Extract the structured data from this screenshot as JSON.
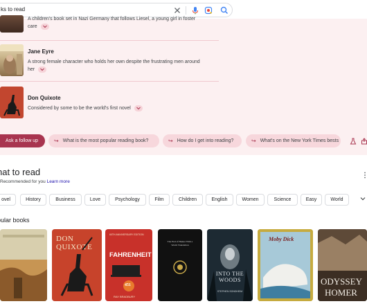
{
  "search": {
    "query": "ks to read"
  },
  "books": [
    {
      "title": "",
      "desc": "A children's book set in Nazi Germany that follows Liesel, a young girl in foster",
      "desc2": "care"
    },
    {
      "title": "Jane Eyre",
      "desc": "A strong female character who holds her own despite the frustrating men around",
      "desc2": "her"
    },
    {
      "title": "Don Quixote",
      "desc": "Considered by some to be the world's first novel",
      "desc2": ""
    }
  ],
  "followup": {
    "button_label": "Ask a follow up",
    "questions": [
      "What is the most popular reading book?",
      "How do I get into reading?",
      "What's on the New York Times bests"
    ]
  },
  "what_to_read": {
    "heading": "hat to read",
    "subtitle": "Recommended for you",
    "learn_more": "Learn more",
    "filters": [
      "ovel",
      "History",
      "Business",
      "Love",
      "Psychology",
      "Film",
      "Children",
      "English",
      "Women",
      "Science",
      "Easy",
      "World"
    ]
  },
  "popular": {
    "heading": "pular books",
    "covers": [
      {
        "text": ""
      },
      {
        "text": "DON QUIXOTE"
      },
      {
        "text": "FAHRENHEIT",
        "sub": "60TH ANNIVERSARY EDITION",
        "num": "451",
        "author": "RAY BRADBURY"
      },
      {
        "text": "The End of Hunter With a Worm Translation"
      },
      {
        "text": "INTO THE WOODS",
        "author": "STEPHEN SONDHEIM"
      },
      {
        "text": "Moby Dick"
      },
      {
        "text": "ODYSSEY",
        "sub": "HOMER"
      }
    ]
  }
}
